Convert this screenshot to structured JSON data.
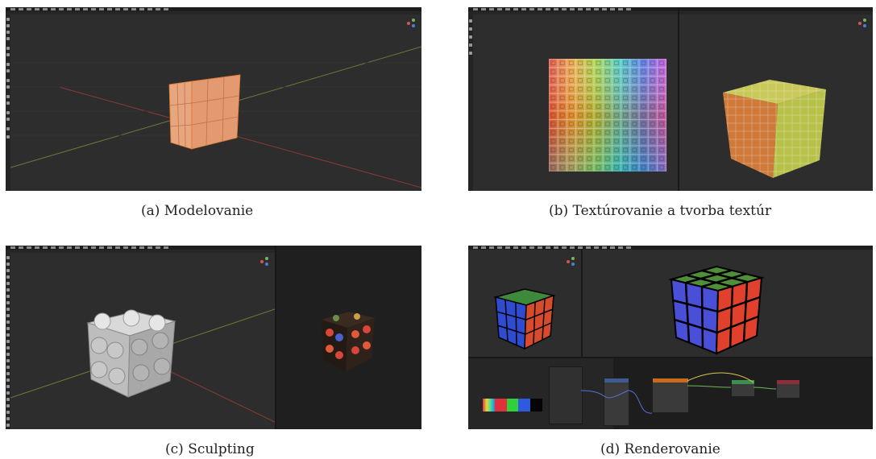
{
  "captions": {
    "a": "(a) Modelovanie",
    "b": "(b) Textúrovanie a tvorba textúr",
    "c": "(c) Sculpting",
    "d": "(d) Renderovanie"
  },
  "colors": {
    "viewport_bg": "#2d2d2d",
    "cube_a": "#e8a67e",
    "edge_orange": "#e07a2e",
    "node_blue": "#3f5b8f",
    "node_orange": "#c96a1c",
    "node_green": "#3e8e4f",
    "node_red": "#8c2f3a"
  },
  "icons": [
    "navigation-gizmo-icon",
    "tool-icon"
  ]
}
